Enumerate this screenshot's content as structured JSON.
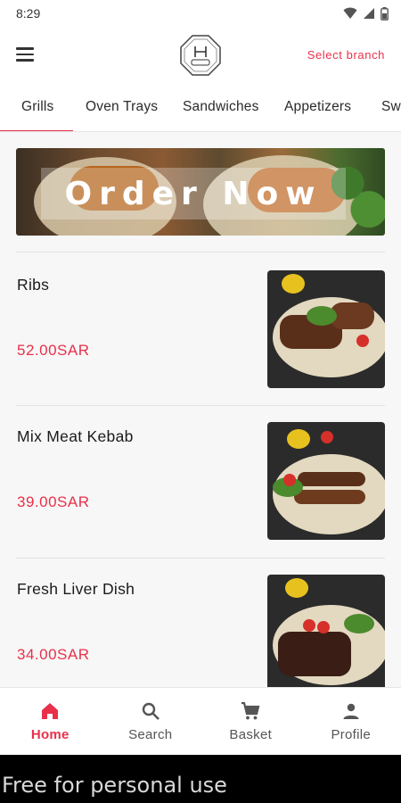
{
  "status_bar": {
    "time": "8:29"
  },
  "header": {
    "select_branch": "Select branch",
    "logo_icon": "restaurant-logo-icon"
  },
  "tabs": [
    {
      "label": "Grills",
      "active": true
    },
    {
      "label": "Oven Trays",
      "active": false
    },
    {
      "label": "Sandwiches",
      "active": false
    },
    {
      "label": "Appetizers",
      "active": false
    },
    {
      "label": "Sw",
      "active": false
    }
  ],
  "banner": {
    "label": "Order Now"
  },
  "menu_items": [
    {
      "name": "Ribs",
      "price": "52.00SAR"
    },
    {
      "name": "Mix Meat Kebab",
      "price": "39.00SAR"
    },
    {
      "name": "Fresh Liver Dish",
      "price": "34.00SAR"
    }
  ],
  "bottom_nav": [
    {
      "label": "Home",
      "icon": "home-icon",
      "active": true
    },
    {
      "label": "Search",
      "icon": "search-icon",
      "active": false
    },
    {
      "label": "Basket",
      "icon": "cart-icon",
      "active": false
    },
    {
      "label": "Profile",
      "icon": "person-icon",
      "active": false
    }
  ],
  "watermark": "Free for personal use",
  "colors": {
    "accent": "#e8304a",
    "background": "#f7f7f7",
    "surface": "#ffffff"
  }
}
